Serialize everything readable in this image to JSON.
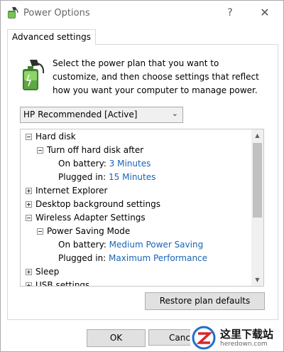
{
  "window": {
    "title": "Power Options",
    "help": "?",
    "close": "✕"
  },
  "tab": {
    "label": "Advanced settings"
  },
  "intro": "Select the power plan that you want to customize, and then choose settings that reflect how you want your computer to manage power.",
  "plan_select": {
    "value": "HP Recommended [Active]"
  },
  "tree": {
    "hard_disk": "Hard disk",
    "turn_off_after": "Turn off hard disk after",
    "hd_on_battery_label": "On battery:",
    "hd_on_battery_value": "3 Minutes",
    "hd_plugged_label": "Plugged in:",
    "hd_plugged_value": "15 Minutes",
    "internet_explorer": "Internet Explorer",
    "desktop_background": "Desktop background settings",
    "wireless": "Wireless Adapter Settings",
    "power_saving_mode": "Power Saving Mode",
    "wl_on_battery_label": "On battery:",
    "wl_on_battery_value": "Medium Power Saving",
    "wl_plugged_label": "Plugged in:",
    "wl_plugged_value": "Maximum Performance",
    "sleep": "Sleep",
    "usb": "USB settings"
  },
  "buttons": {
    "restore": "Restore plan defaults",
    "ok": "OK",
    "cancel": "Cancel"
  },
  "watermark": {
    "cn": "这里下载站",
    "en": "heredown.com"
  },
  "colors": {
    "link": "#1a63b6",
    "button_bg": "#e1e1e1"
  }
}
